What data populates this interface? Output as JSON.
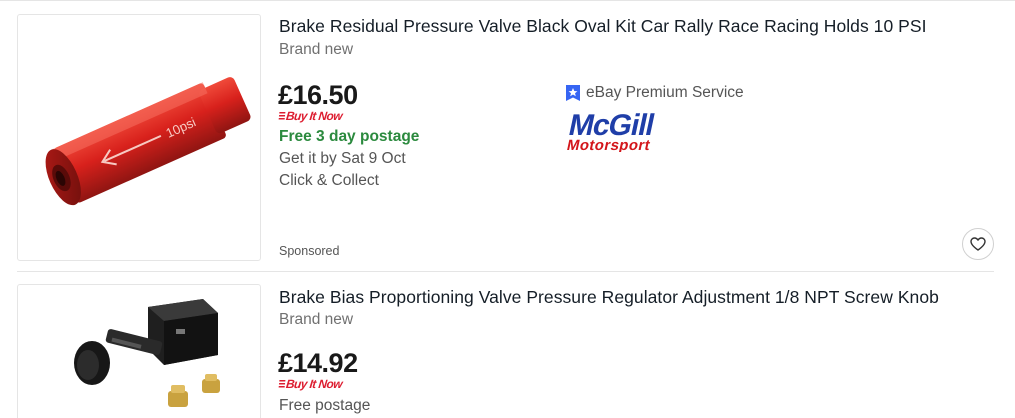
{
  "listings": [
    {
      "title": "Brake Residual Pressure Valve Black Oval Kit Car Rally Race Racing Holds 10 PSI",
      "condition": "Brand new",
      "price": "£16.50",
      "buy_format": "Buy It Now",
      "shipping": "Free 3 day postage",
      "delivery": "Get it by Sat 9 Oct",
      "collect": "Click & Collect",
      "sponsored": "Sponsored",
      "premium_service": "eBay Premium Service",
      "seller_logo_text": "McGill Motorsport",
      "image_label": "10psi",
      "colors": {
        "product": "#d8211c",
        "shipping_green": "#2b8a3e",
        "bin_red": "#dd1e31",
        "logo_blue": "#1f3ea8",
        "logo_red": "#d3161b",
        "badge_blue": "#3665f3"
      },
      "icons": [
        "premium-badge-icon",
        "heart-icon"
      ]
    },
    {
      "title": "Brake Bias Proportioning Valve Pressure Regulator Adjustment 1/8 NPT Screw Knob",
      "condition": "Brand new",
      "price": "£14.92",
      "buy_format": "Buy It Now",
      "shipping": "Free postage",
      "colors": {
        "product": "#1a1a1a",
        "fitting": "#c9a23f"
      }
    }
  ]
}
